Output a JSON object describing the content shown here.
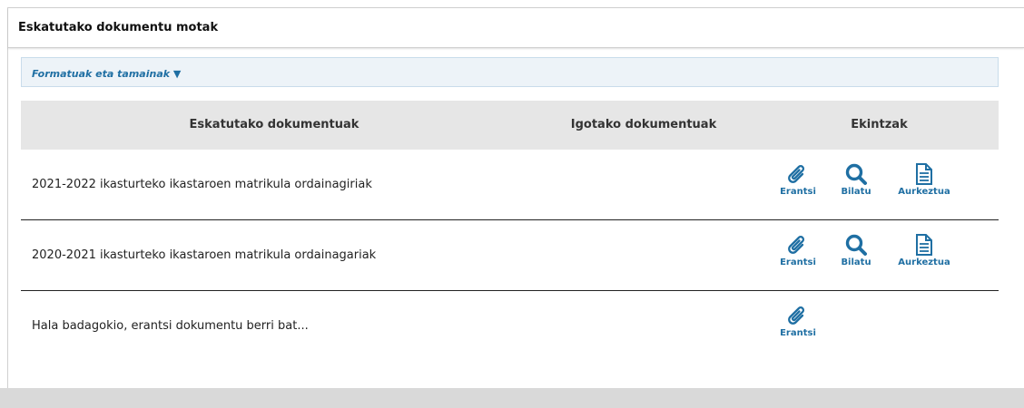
{
  "panel": {
    "title": "Eskatutako dokumentu motak"
  },
  "formats": {
    "label": "Formatuak eta tamainak ▼"
  },
  "table": {
    "headers": {
      "requested": "Eskatutako dokumentuak",
      "uploaded": "Igotako dokumentuak",
      "actions": "Ekintzak"
    },
    "rows": [
      {
        "document": "2021-2022 ikasturteko ikastaroen matrikula ordainagiriak",
        "uploaded": "",
        "actions": {
          "attach": "Erantsi",
          "search": "Bilatu",
          "present": "Aurkeztua"
        }
      },
      {
        "document": "2020-2021 ikasturteko ikastaroen matrikula ordainagariak",
        "uploaded": "",
        "actions": {
          "attach": "Erantsi",
          "search": "Bilatu",
          "present": "Aurkeztua"
        }
      },
      {
        "document": "Hala badagokio, erantsi dokumentu berri bat...",
        "uploaded": "",
        "actions": {
          "attach": "Erantsi"
        }
      }
    ]
  },
  "icons": {
    "attach": "paperclip-icon",
    "search": "magnifier-icon",
    "present": "document-icon"
  },
  "colors": {
    "accent": "#1f6fa3",
    "header_bg": "#e6e6e6",
    "formats_bg": "#edf3f8"
  }
}
